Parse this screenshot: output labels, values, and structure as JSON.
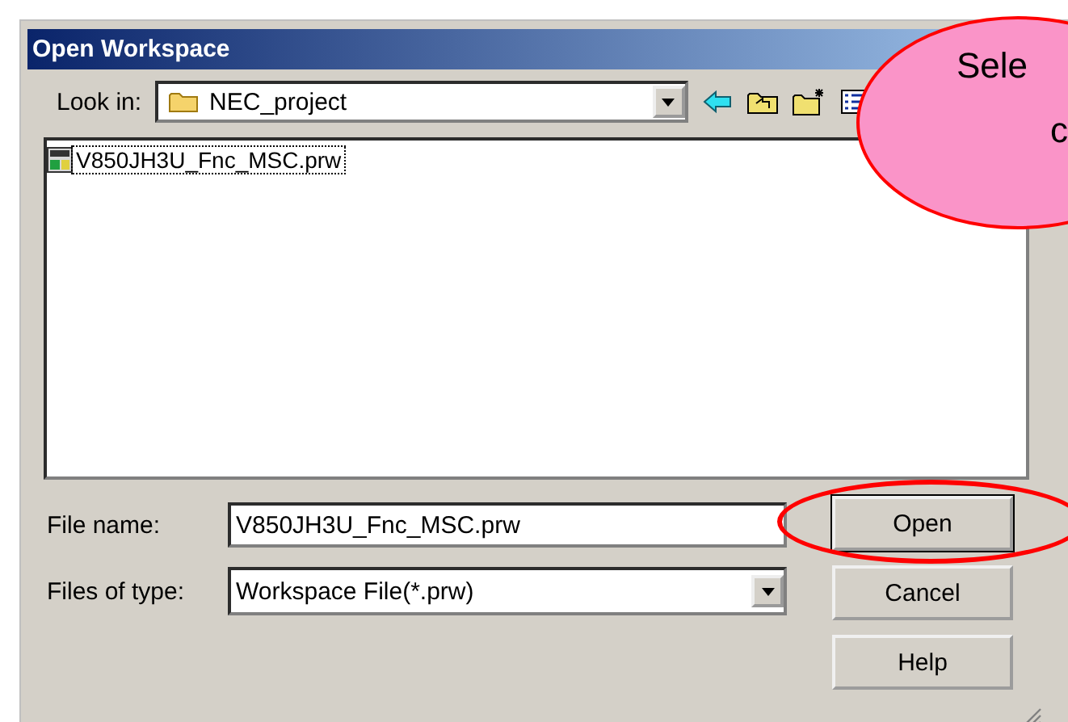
{
  "window": {
    "title": "Open Workspace"
  },
  "look_in": {
    "label": "Look in:",
    "value": "NEC_project"
  },
  "files": [
    {
      "name": "V850JH3U_Fnc_MSC.prw",
      "selected": true
    }
  ],
  "file_name": {
    "label": "File name:",
    "value": "V850JH3U_Fnc_MSC.prw"
  },
  "file_type": {
    "label": "Files of type:",
    "value": "Workspace File(*.prw)"
  },
  "buttons": [
    {
      "label": "Open",
      "highlighted": true
    },
    {
      "label": "Cancel",
      "highlighted": false
    },
    {
      "label": "Help",
      "highlighted": false
    }
  ],
  "callout": {
    "lines": [
      "Sele",
      "c"
    ]
  }
}
